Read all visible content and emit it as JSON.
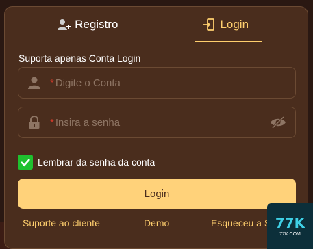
{
  "tabs": {
    "register_label": "Registro",
    "login_label": "Login"
  },
  "form": {
    "hint": "Suporta apenas Conta Login",
    "account_required_mark": "*",
    "account_placeholder": "Digite o Conta",
    "password_required_mark": "*",
    "password_placeholder": "Insira a senha",
    "remember_label": "Lembrar da senha da conta",
    "remember_checked": true,
    "submit_label": "Login"
  },
  "links": {
    "support": "Suporte ao cliente",
    "demo": "Demo",
    "forgot": "Esqueceu a S"
  },
  "badge": {
    "logo_text": "77K",
    "domain_text": "77K.COM"
  },
  "colors": {
    "accent": "#ffcf6e",
    "panel": "#4a2d1d",
    "button": "#ffd27a",
    "checkbox": "#1fc12f"
  }
}
